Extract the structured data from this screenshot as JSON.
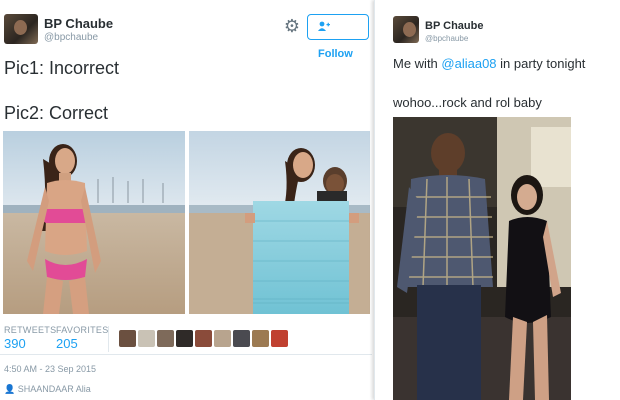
{
  "left_tweet": {
    "author_name": "BP Chaube",
    "author_handle": "@bpchaube",
    "follow_label": "Follow",
    "line1": "Pic1: Incorrect",
    "line2": "Pic2: Correct",
    "stats": {
      "retweets_label": "RETWEETS",
      "retweets_count": "390",
      "favorites_label": "FAVORITES",
      "favorites_count": "205"
    },
    "timestamp": "4:50 AM - 23 Sep 2015",
    "context": "SHAANDAAR Alia"
  },
  "right_tweet": {
    "author_name": "BP Chaube",
    "author_handle": "@bpchaube",
    "text_prefix": "Me with ",
    "mention": "@aliaa08",
    "text_suffix": " in party tonight",
    "line2": "wohoo...rock and rol baby"
  },
  "colors": {
    "accent": "#1da1f2",
    "text": "#292f33",
    "muted": "#8899a6"
  }
}
